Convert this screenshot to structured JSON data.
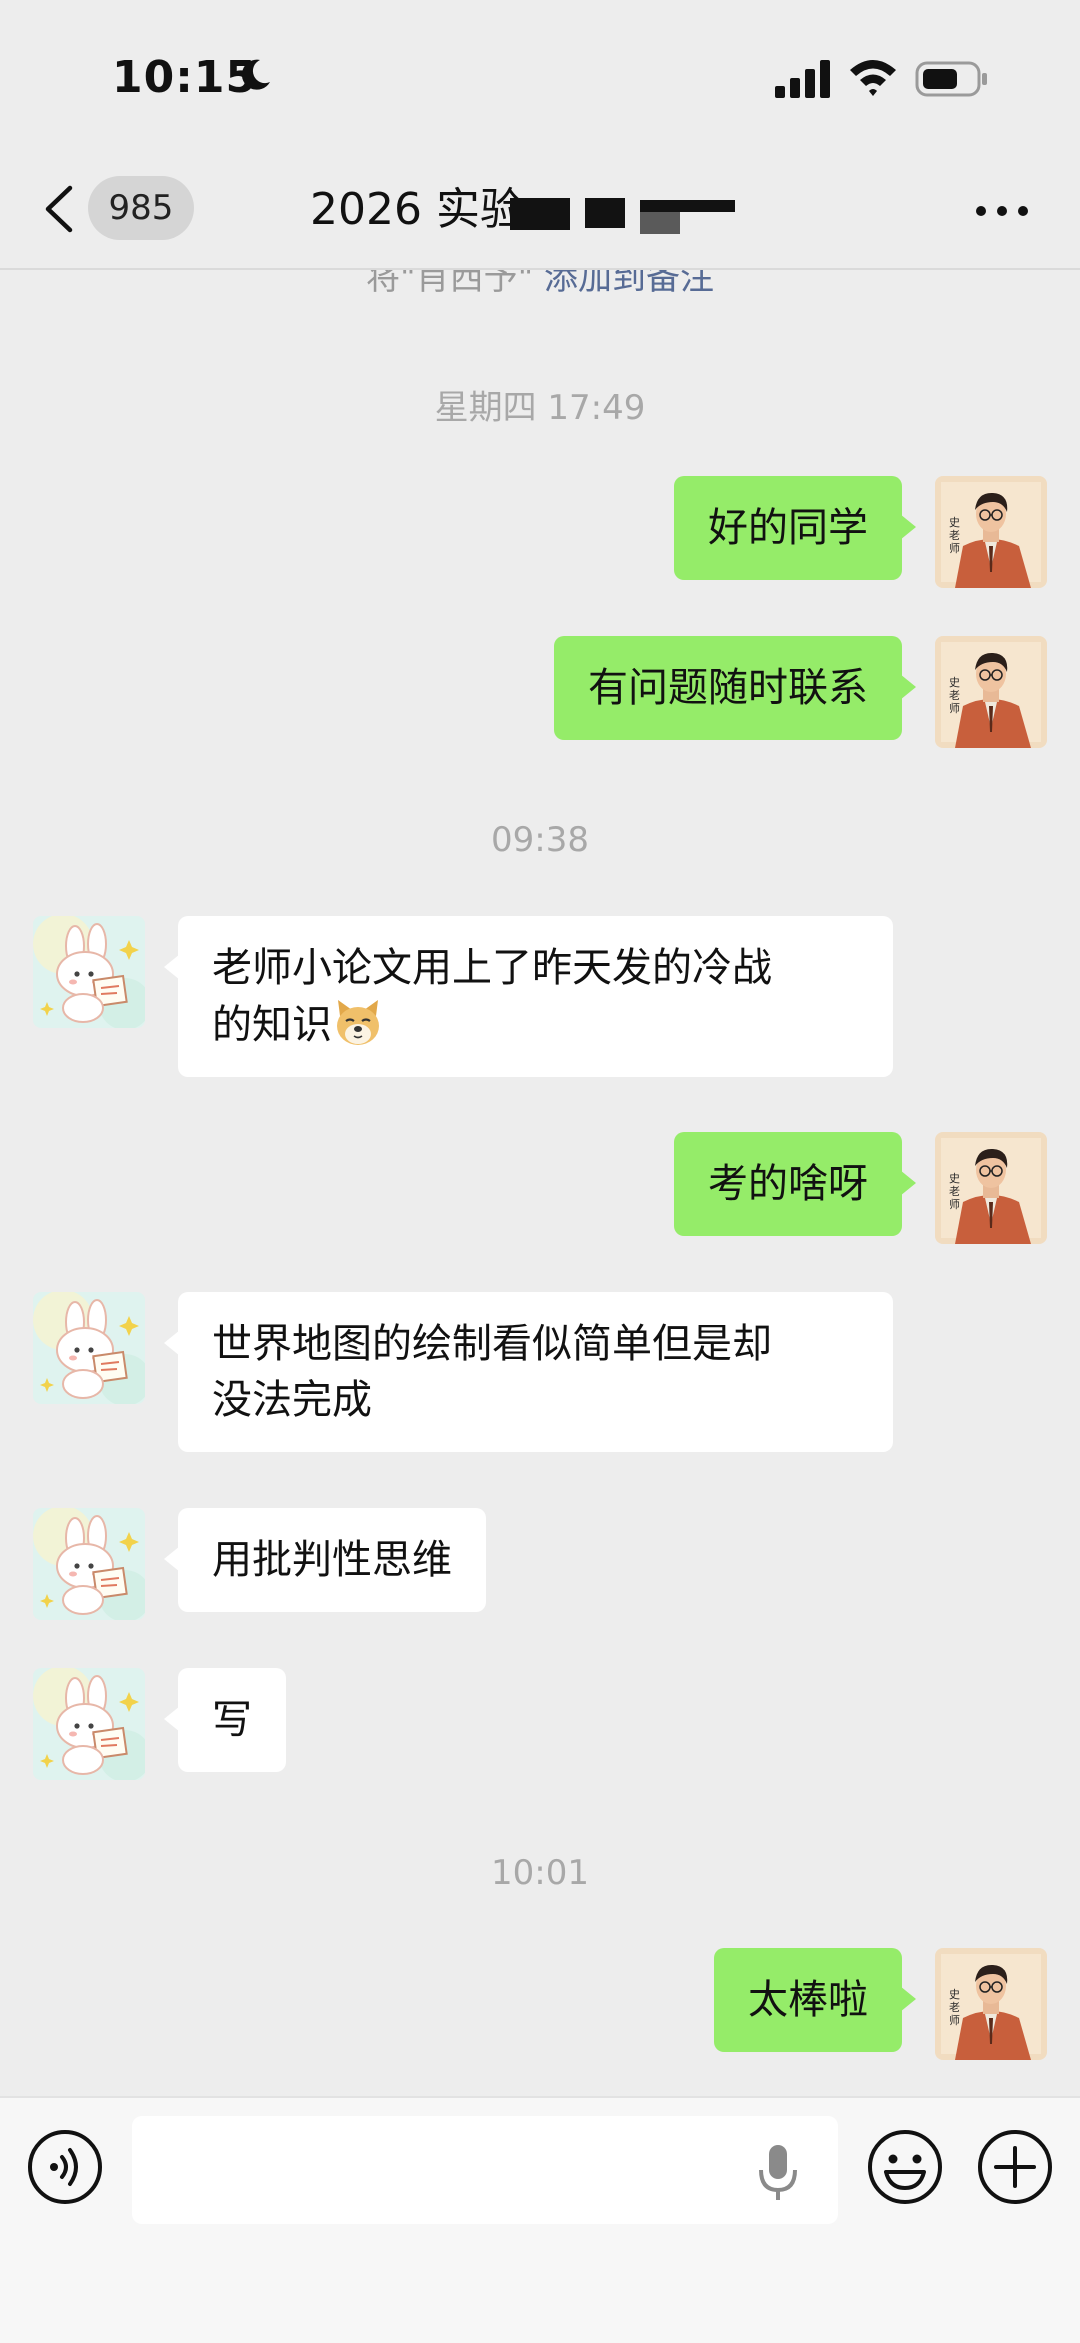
{
  "status_bar": {
    "time": "10:15"
  },
  "nav": {
    "unread_count": "985",
    "title": "2026 实验"
  },
  "system_hint": {
    "prefix": "将\"肖西予\" ",
    "link": "添加到备注"
  },
  "timestamps": [
    "星期四 17:49",
    "09:38",
    "10:01"
  ],
  "messages": [
    {
      "from": "me",
      "text": "好的同学"
    },
    {
      "from": "me",
      "text": "有问题随时联系"
    },
    {
      "from": "them",
      "line1": "老师小论文用上了昨天发的冷战",
      "line2": "的知识"
    },
    {
      "from": "me",
      "text": "考的啥呀"
    },
    {
      "from": "them",
      "line1": "世界地图的绘制看似简单但是却",
      "line2": "没法完成"
    },
    {
      "from": "them",
      "text": "用批判性思维"
    },
    {
      "from": "them",
      "text": "写"
    },
    {
      "from": "me",
      "text": "太棒啦"
    }
  ],
  "avatars": {
    "me_label": "史老师"
  },
  "icons": {
    "moon": "moon-icon",
    "signal": "cellular-signal-icon",
    "wifi": "wifi-icon",
    "battery": "battery-icon",
    "back": "chevron-left-icon",
    "more": "more-dots-icon",
    "voice": "voice-input-icon",
    "mic": "microphone-icon",
    "emoji": "emoji-icon",
    "plus": "plus-icon",
    "doge": "doge-emoji"
  },
  "colors": {
    "background": "#ededed",
    "my_bubble": "#95ec69",
    "their_bubble": "#ffffff",
    "link": "#576b95",
    "timestamp": "#a8a8a8"
  }
}
